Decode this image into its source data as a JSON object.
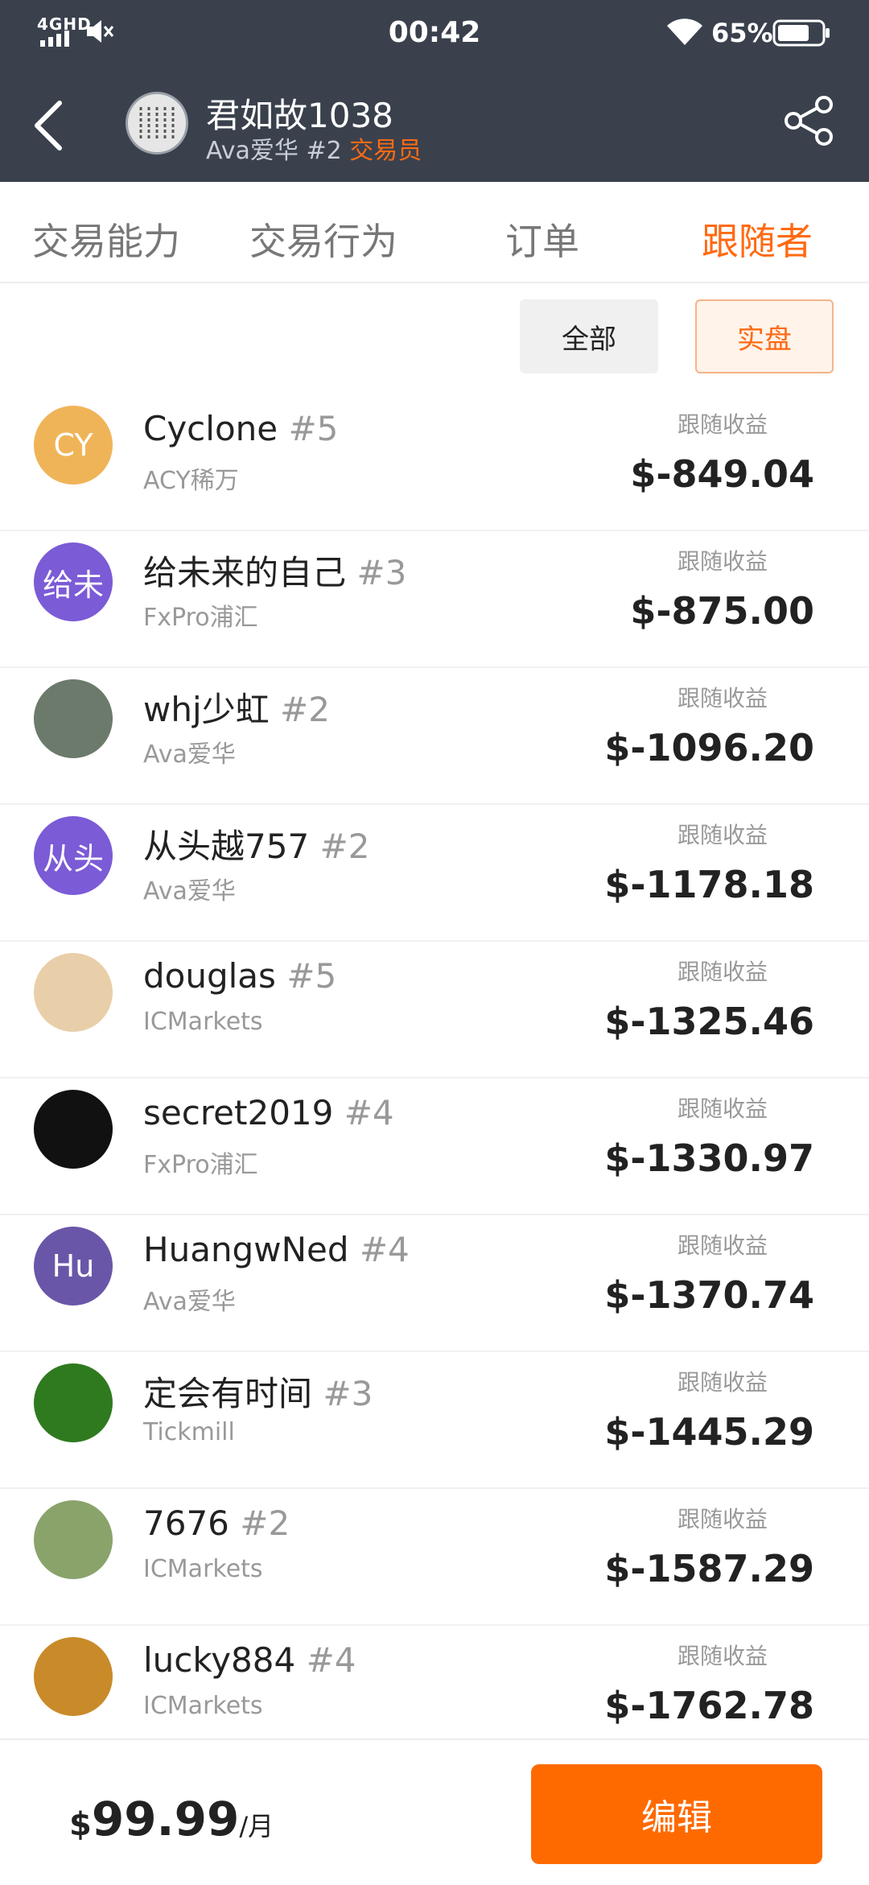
{
  "status_bar": {
    "network": "4GHD",
    "time": "00:42",
    "battery": "65%"
  },
  "header": {
    "trader_name": "君如故1038",
    "broker_rank": "Ava爱华 #2",
    "role": "交易员"
  },
  "tabs": [
    {
      "label": "交易能力",
      "active": false
    },
    {
      "label": "交易行为",
      "active": false
    },
    {
      "label": "订单",
      "active": false
    },
    {
      "label": "跟随者",
      "active": true
    }
  ],
  "filters": {
    "all": "全部",
    "real": "实盘"
  },
  "followers": [
    {
      "name": "Cyclone",
      "rank": "#5",
      "broker": "ACY稀万",
      "profit_label": "跟随收益",
      "profit": "$-849.04",
      "avatar_text": "CY",
      "avatar_color": "#f0b458"
    },
    {
      "name": "给未来的自己",
      "rank": "#3",
      "broker": "FxPro浦汇",
      "profit_label": "跟随收益",
      "profit": "$-875.00",
      "avatar_text": "给未",
      "avatar_color": "#7b5bd6"
    },
    {
      "name": "whj少虹",
      "rank": "#2",
      "broker": "Ava爱华",
      "profit_label": "跟随收益",
      "profit": "$-1096.20",
      "avatar_text": "",
      "avatar_color": "#6b7a6a"
    },
    {
      "name": "从头越757",
      "rank": "#2",
      "broker": "Ava爱华",
      "profit_label": "跟随收益",
      "profit": "$-1178.18",
      "avatar_text": "从头",
      "avatar_color": "#7b5bd6"
    },
    {
      "name": "douglas",
      "rank": "#5",
      "broker": "ICMarkets",
      "profit_label": "跟随收益",
      "profit": "$-1325.46",
      "avatar_text": "",
      "avatar_color": "#e9cfa9"
    },
    {
      "name": "secret2019",
      "rank": "#4",
      "broker": "FxPro浦汇",
      "profit_label": "跟随收益",
      "profit": "$-1330.97",
      "avatar_text": "",
      "avatar_color": "#111111"
    },
    {
      "name": "HuangwNed",
      "rank": "#4",
      "broker": "Ava爱华",
      "profit_label": "跟随收益",
      "profit": "$-1370.74",
      "avatar_text": "Hu",
      "avatar_color": "#6a56a8"
    },
    {
      "name": "定会有时间",
      "rank": "#3",
      "broker": "Tickmill",
      "profit_label": "跟随收益",
      "profit": "$-1445.29",
      "avatar_text": "",
      "avatar_color": "#2f7a1f"
    },
    {
      "name": "7676",
      "rank": "#2",
      "broker": "ICMarkets",
      "profit_label": "跟随收益",
      "profit": "$-1587.29",
      "avatar_text": "",
      "avatar_color": "#8aa36b"
    },
    {
      "name": "lucky884",
      "rank": "#4",
      "broker": "ICMarkets",
      "profit_label": "跟随收益",
      "profit": "$-1762.78",
      "avatar_text": "",
      "avatar_color": "#c98a2a"
    }
  ],
  "footer": {
    "currency": "$",
    "amount": "99.99",
    "per": "/月",
    "edit_label": "编辑"
  }
}
